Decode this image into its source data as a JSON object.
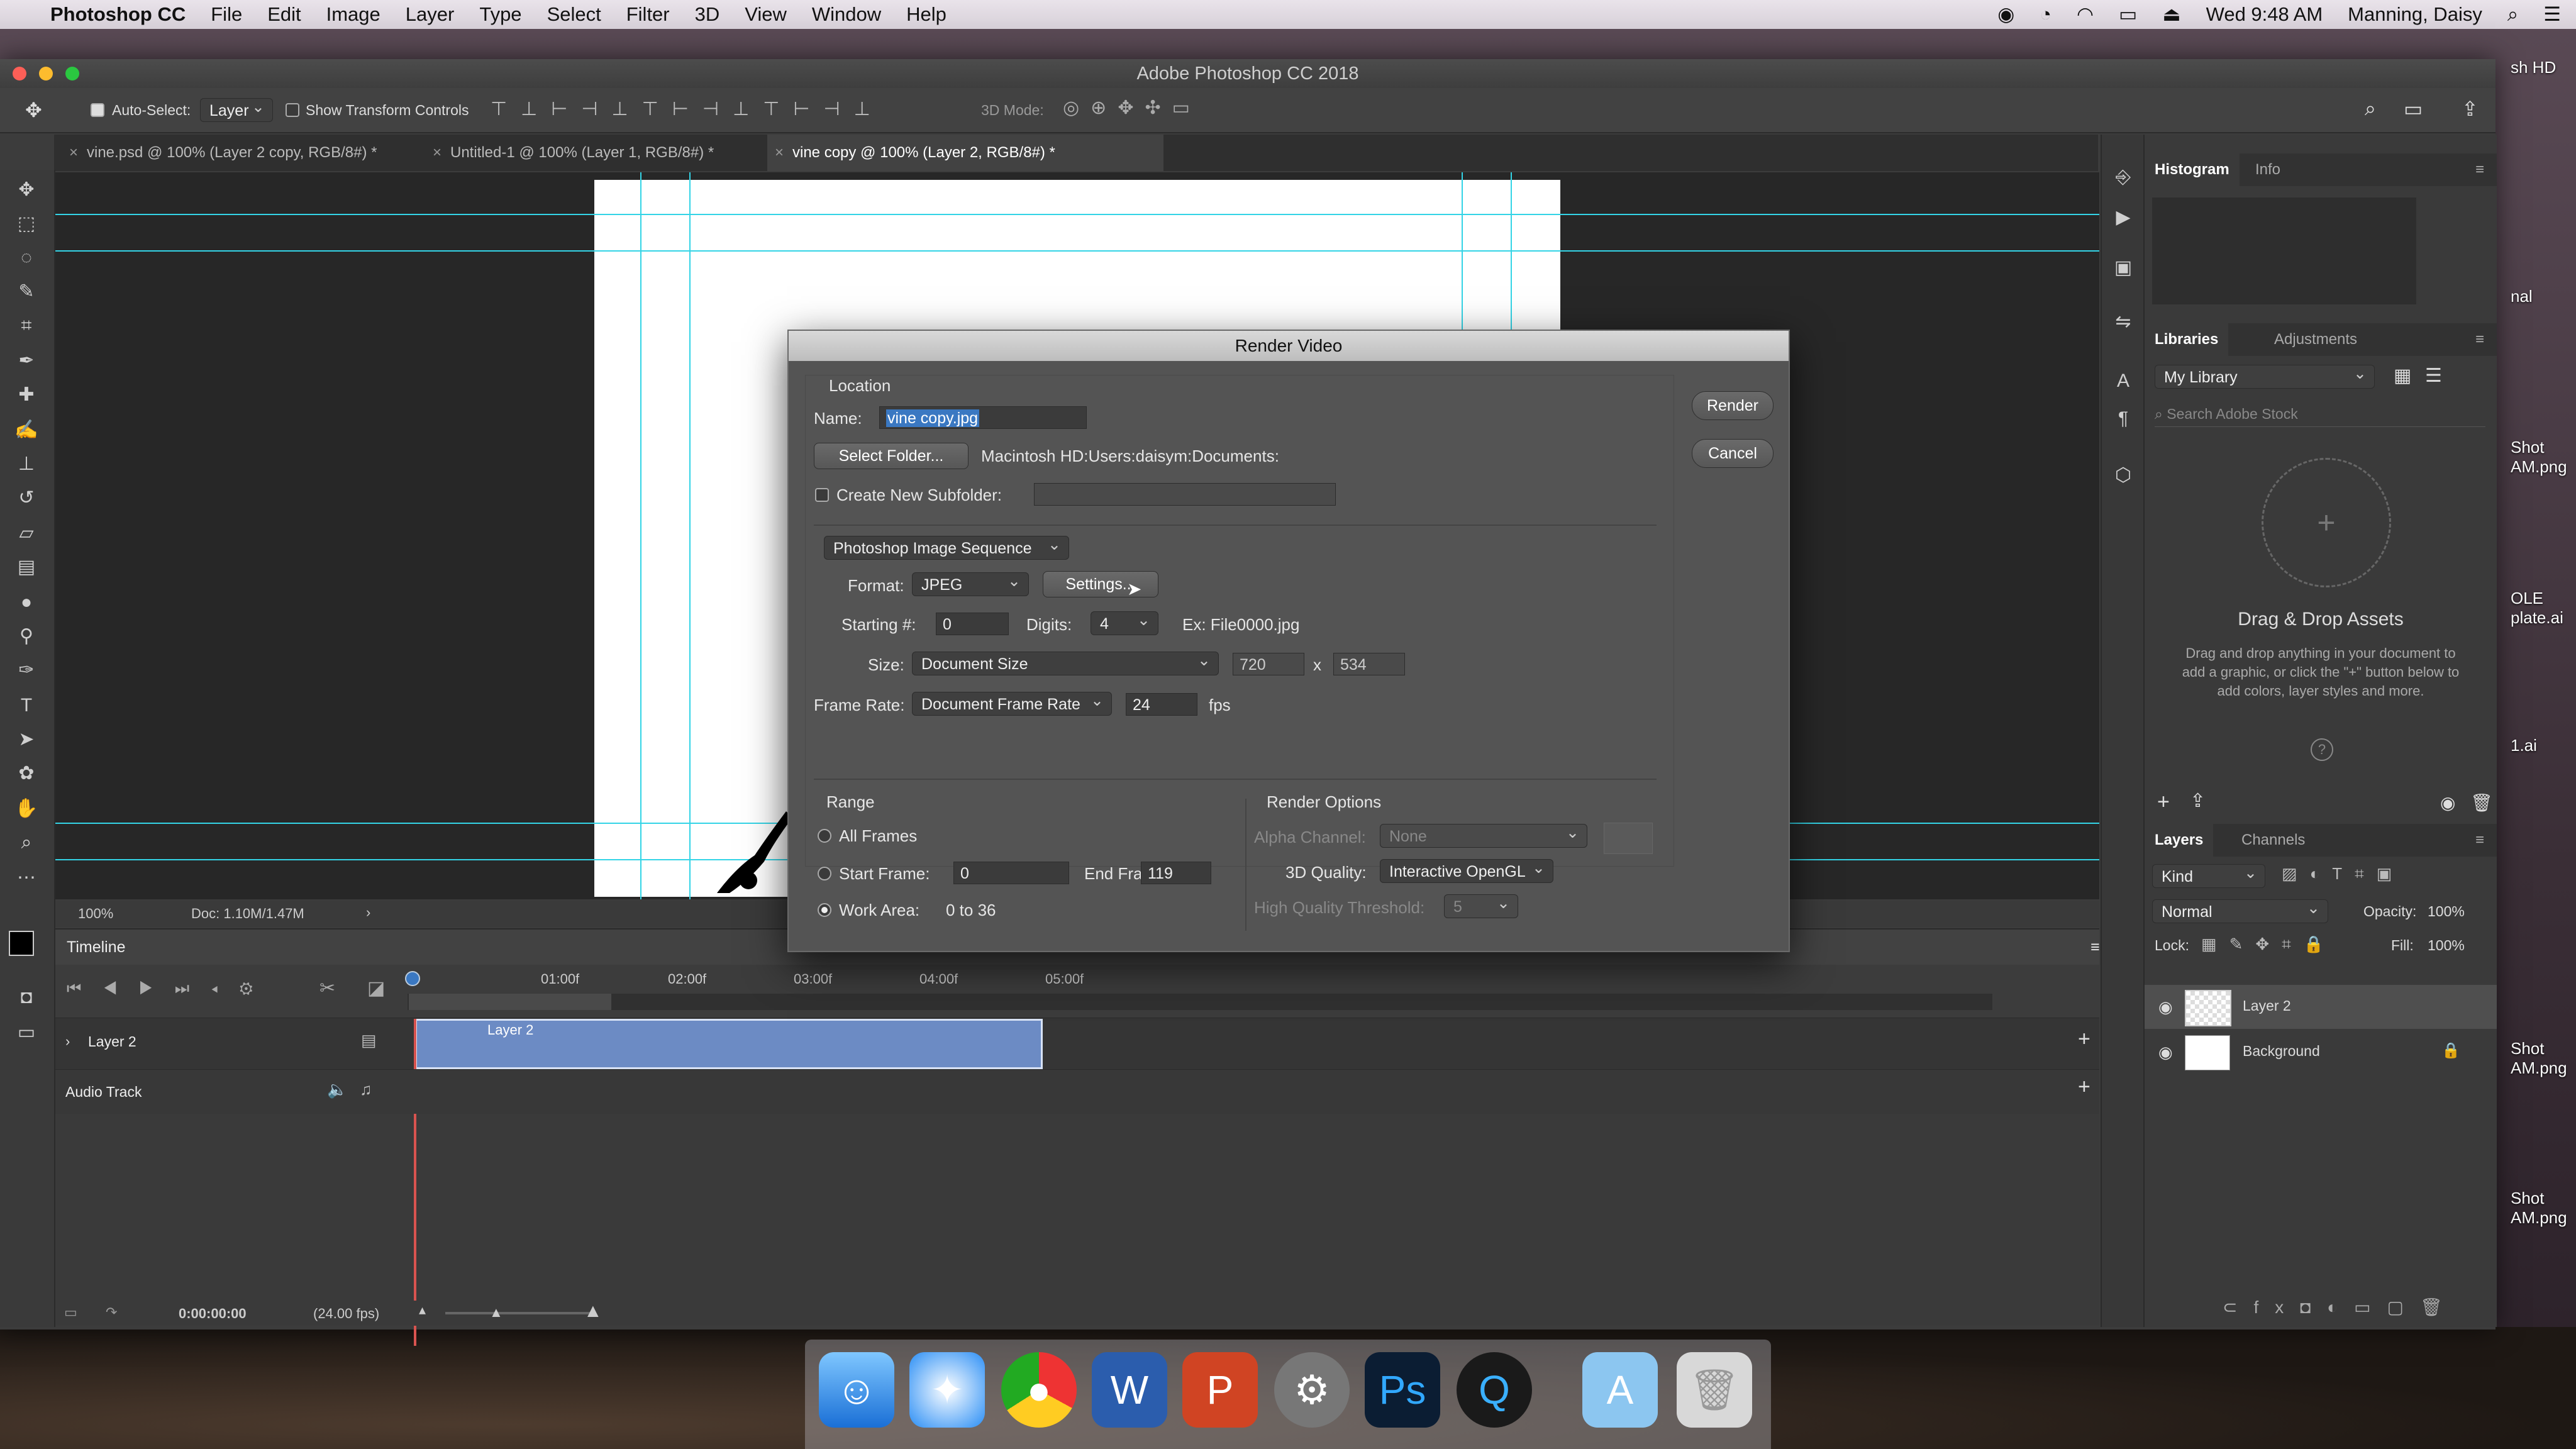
{
  "menubar": {
    "apple": "",
    "app": "Photoshop CC",
    "items": [
      "File",
      "Edit",
      "Image",
      "Layer",
      "Type",
      "Select",
      "Filter",
      "3D",
      "View",
      "Window",
      "Help"
    ],
    "clock": "Wed 9:48 AM",
    "user": "Manning, Daisy"
  },
  "window": {
    "title": "Adobe Photoshop CC 2018"
  },
  "options": {
    "auto_select_label": "Auto-Select:",
    "auto_select_value": "Layer",
    "transform_label": "Show Transform Controls",
    "mode3d": "3D Mode:"
  },
  "tabs": [
    {
      "label": "vine.psd @ 100% (Layer 2 copy, RGB/8#) *"
    },
    {
      "label": "Untitled-1 @ 100% (Layer 1, RGB/8#) *"
    },
    {
      "label": "vine copy @ 100% (Layer 2, RGB/8#) *"
    }
  ],
  "status": {
    "zoom": "100%",
    "doc": "Doc: 1.10M/1.47M"
  },
  "timeline": {
    "title": "Timeline",
    "ruler": [
      "01:00f",
      "02:00f",
      "03:00f",
      "04:00f",
      "05:00f"
    ],
    "track_name": "Layer 2",
    "clip_label": "Layer 2",
    "audio_label": "Audio Track",
    "timecode": "0:00:00:00",
    "fps": "(24.00 fps)"
  },
  "panels": {
    "histogram_tab": "Histogram",
    "info_tab": "Info",
    "libraries_tab": "Libraries",
    "adjustments_tab": "Adjustments",
    "library_select": "My Library",
    "search_placeholder": "Search Adobe Stock",
    "drag_title": "Drag & Drop Assets",
    "drag_text": "Drag and drop anything in your document to add a graphic, or click the \"+\" button below to add colors, layer styles and more.",
    "layers_tab": "Layers",
    "channels_tab": "Channels",
    "kind": "Kind",
    "blend": "Normal",
    "opacity_label": "Opacity:",
    "opacity": "100%",
    "lock_label": "Lock:",
    "fill_label": "Fill:",
    "fill": "100%",
    "layers": [
      {
        "name": "Layer 2"
      },
      {
        "name": "Background"
      }
    ]
  },
  "dialog": {
    "title": "Render Video",
    "location_label": "Location",
    "name_label": "Name:",
    "name_value": "vine copy.jpg",
    "select_folder": "Select Folder...",
    "path": "Macintosh HD:Users:daisym:Documents:",
    "subfolder_label": "Create New Subfolder:",
    "sequence": "Photoshop Image Sequence",
    "format_label": "Format:",
    "format": "JPEG",
    "settings": "Settings...",
    "starting_label": "Starting #:",
    "starting": "0",
    "digits_label": "Digits:",
    "digits": "4",
    "example": "Ex: File0000.jpg",
    "size_label": "Size:",
    "size": "Document Size",
    "width": "720",
    "x": "x",
    "height": "534",
    "framerate_label": "Frame Rate:",
    "framerate": "Document Frame Rate",
    "fps_value": "24",
    "fps_unit": "fps",
    "range_label": "Range",
    "all_frames": "All Frames",
    "start_frame_label": "Start Frame:",
    "start_frame": "0",
    "end_frame_label": "End Frame:",
    "end_frame": "119",
    "work_area": "Work Area:",
    "work_area_value": "0 to 36",
    "render_options": "Render Options",
    "alpha_label": "Alpha Channel:",
    "alpha": "None",
    "quality_label": "3D Quality:",
    "quality": "Interactive OpenGL",
    "threshold_label": "High Quality Threshold:",
    "threshold": "5",
    "render_btn": "Render",
    "cancel_btn": "Cancel"
  },
  "desktop_files": [
    "sh HD",
    "nal",
    "Shot AM.png",
    "OLE plate.ai",
    "1.ai",
    "Shot AM.png",
    "Shot AM.png"
  ],
  "colors": {
    "guide": "#34d4e6",
    "clip": "#6c8bc4",
    "accent": "#3a78c2"
  }
}
